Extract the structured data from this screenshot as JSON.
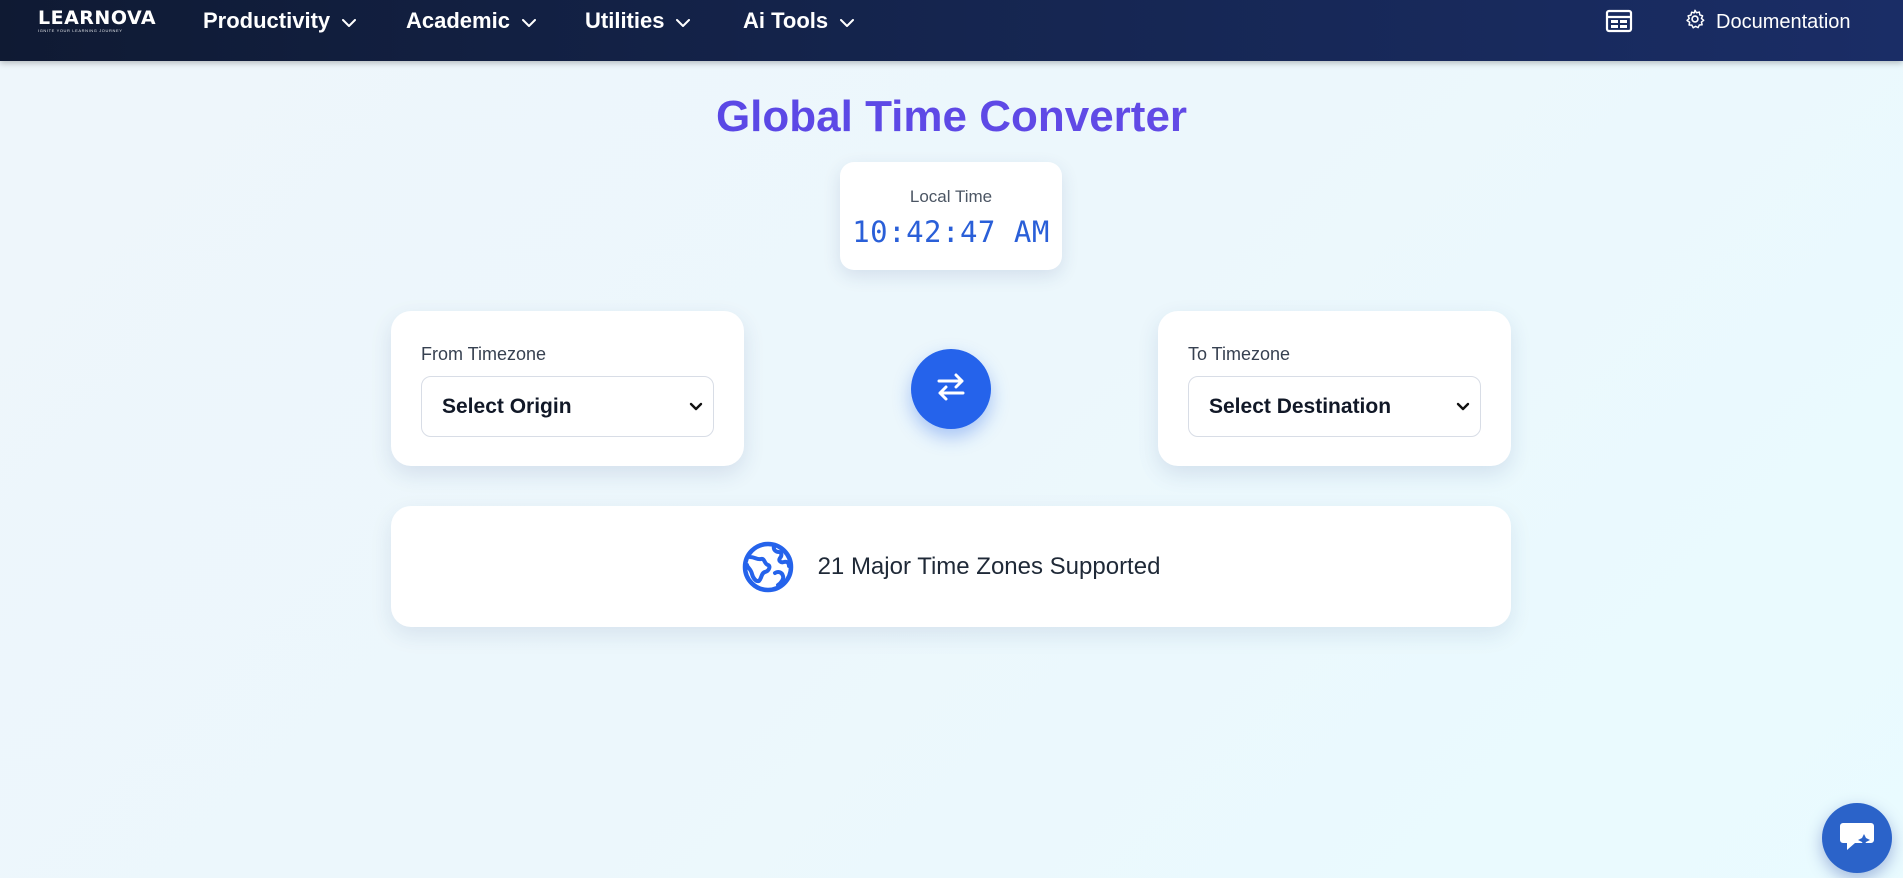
{
  "brand": {
    "name": "LEARNOVA",
    "tagline": "IGNITE YOUR LEARNING JOURNEY"
  },
  "nav": {
    "items": [
      {
        "label": "Productivity"
      },
      {
        "label": "Academic"
      },
      {
        "label": "Utilities"
      },
      {
        "label": "Ai Tools"
      }
    ],
    "calendar_icon": "calendar-layout-icon",
    "docs_label": "Documentation",
    "docs_icon": "gear-icon"
  },
  "page": {
    "title": "Global Time Converter"
  },
  "local_time": {
    "label": "Local Time",
    "value": "10:42:47 AM"
  },
  "from_timezone": {
    "label": "From Timezone",
    "selected": "Select Origin"
  },
  "to_timezone": {
    "label": "To Timezone",
    "selected": "Select Destination"
  },
  "swap": {
    "icon": "swap-arrows-icon"
  },
  "info": {
    "icon": "globe-icon",
    "text": "21 Major Time Zones Supported"
  },
  "chat": {
    "icon": "chat-bubble-icon"
  },
  "colors": {
    "nav_start": "#0f1a33",
    "nav_end": "#1a2d66",
    "title": "#4f46e5",
    "accent_blue": "#2563eb",
    "time_text": "#2a5fd8",
    "chat_button": "#2b63c9"
  }
}
